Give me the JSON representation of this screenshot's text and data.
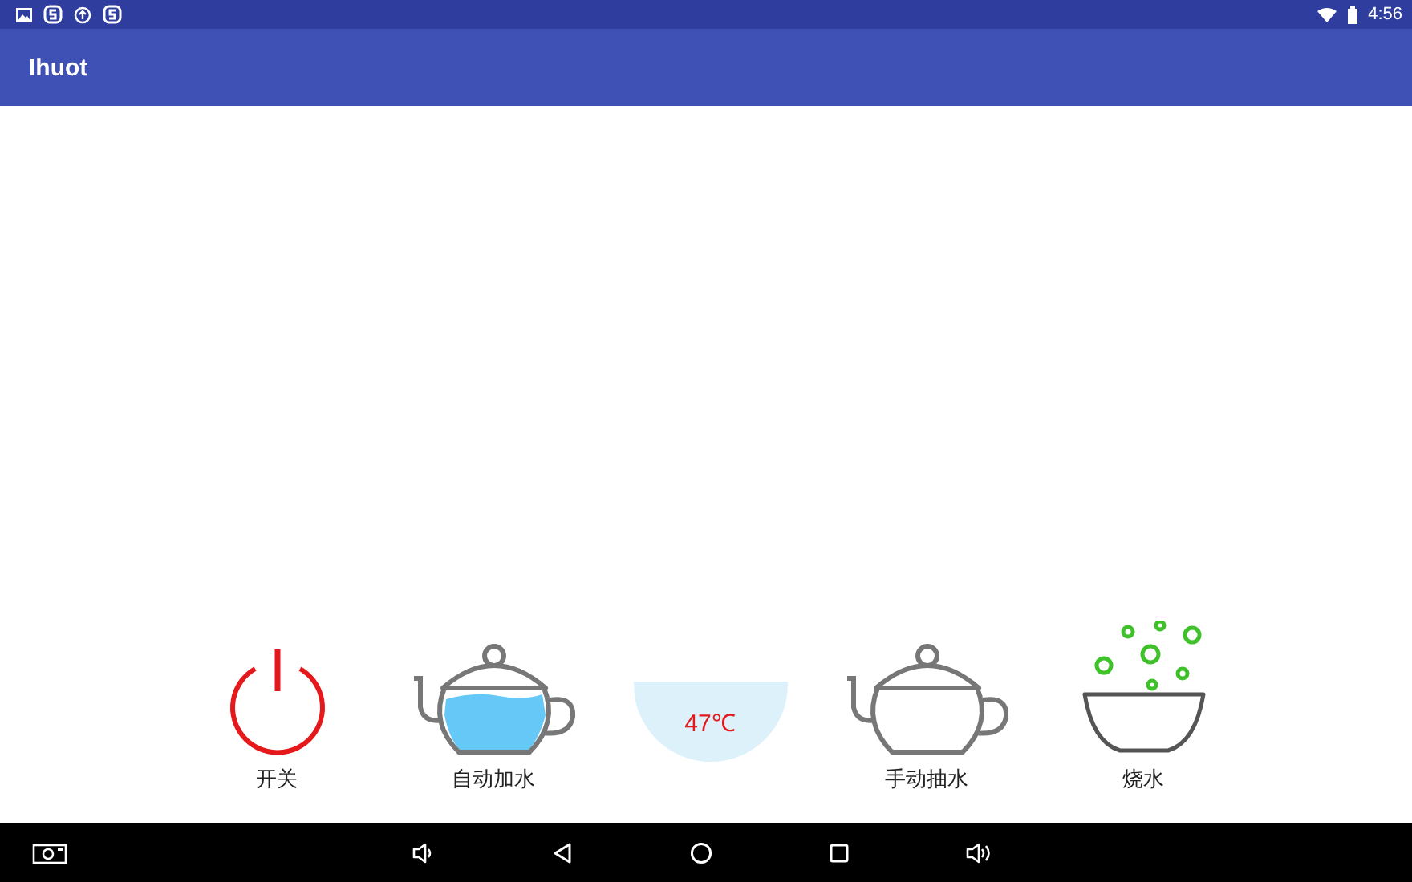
{
  "status_bar": {
    "time": "4:56"
  },
  "app_bar": {
    "title": "Ihuot"
  },
  "controls": [
    {
      "kind": "power",
      "label": "开关"
    },
    {
      "kind": "kettle-filled",
      "label": "自动加水"
    },
    {
      "kind": "temperature",
      "reading": "47℃"
    },
    {
      "kind": "kettle",
      "label": "手动抽水"
    },
    {
      "kind": "boil",
      "label": "烧水"
    }
  ]
}
